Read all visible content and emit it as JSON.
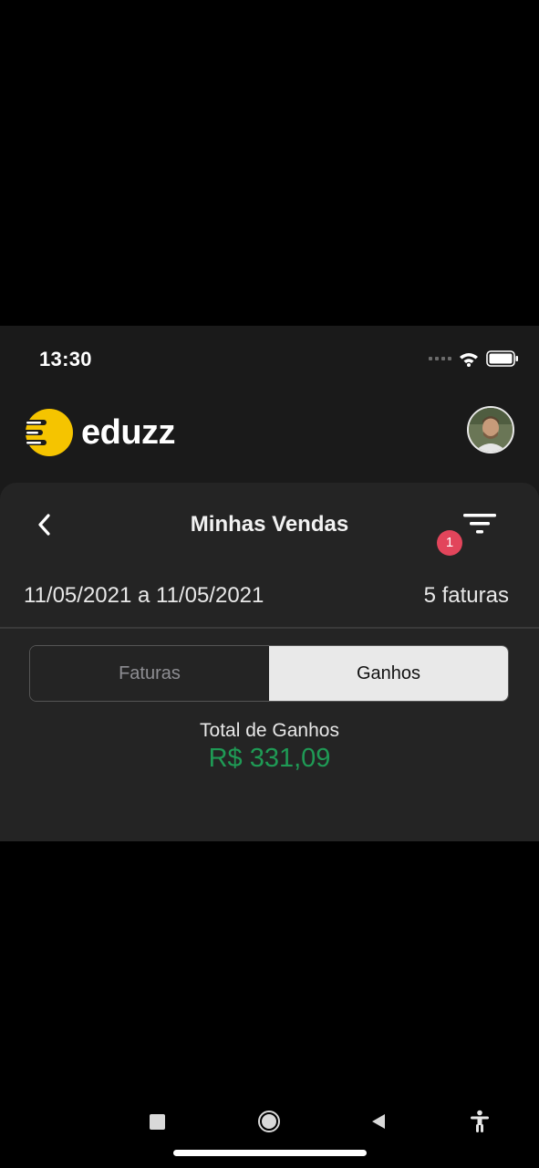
{
  "status_bar": {
    "time": "13:30"
  },
  "header": {
    "brand_name": "eduzz",
    "brand_color": "#f5c400",
    "avatar_icon": "user-avatar"
  },
  "page": {
    "title": "Minhas Vendas",
    "back_icon": "chevron-left-icon",
    "filter_icon": "filter-icon",
    "filter_badge": "1"
  },
  "summary": {
    "date_range": "11/05/2021 a 11/05/2021",
    "invoice_count": "5 faturas"
  },
  "tabs": [
    {
      "label": "Faturas",
      "active": false
    },
    {
      "label": "Ganhos",
      "active": true
    }
  ],
  "earnings": {
    "label": "Total de Ganhos",
    "value": "R$  331,09",
    "value_color": "#1f9a55"
  },
  "colors": {
    "background": "#000000",
    "app_background": "#1a1a1a",
    "card_background": "#242424",
    "badge": "#e2455b"
  }
}
